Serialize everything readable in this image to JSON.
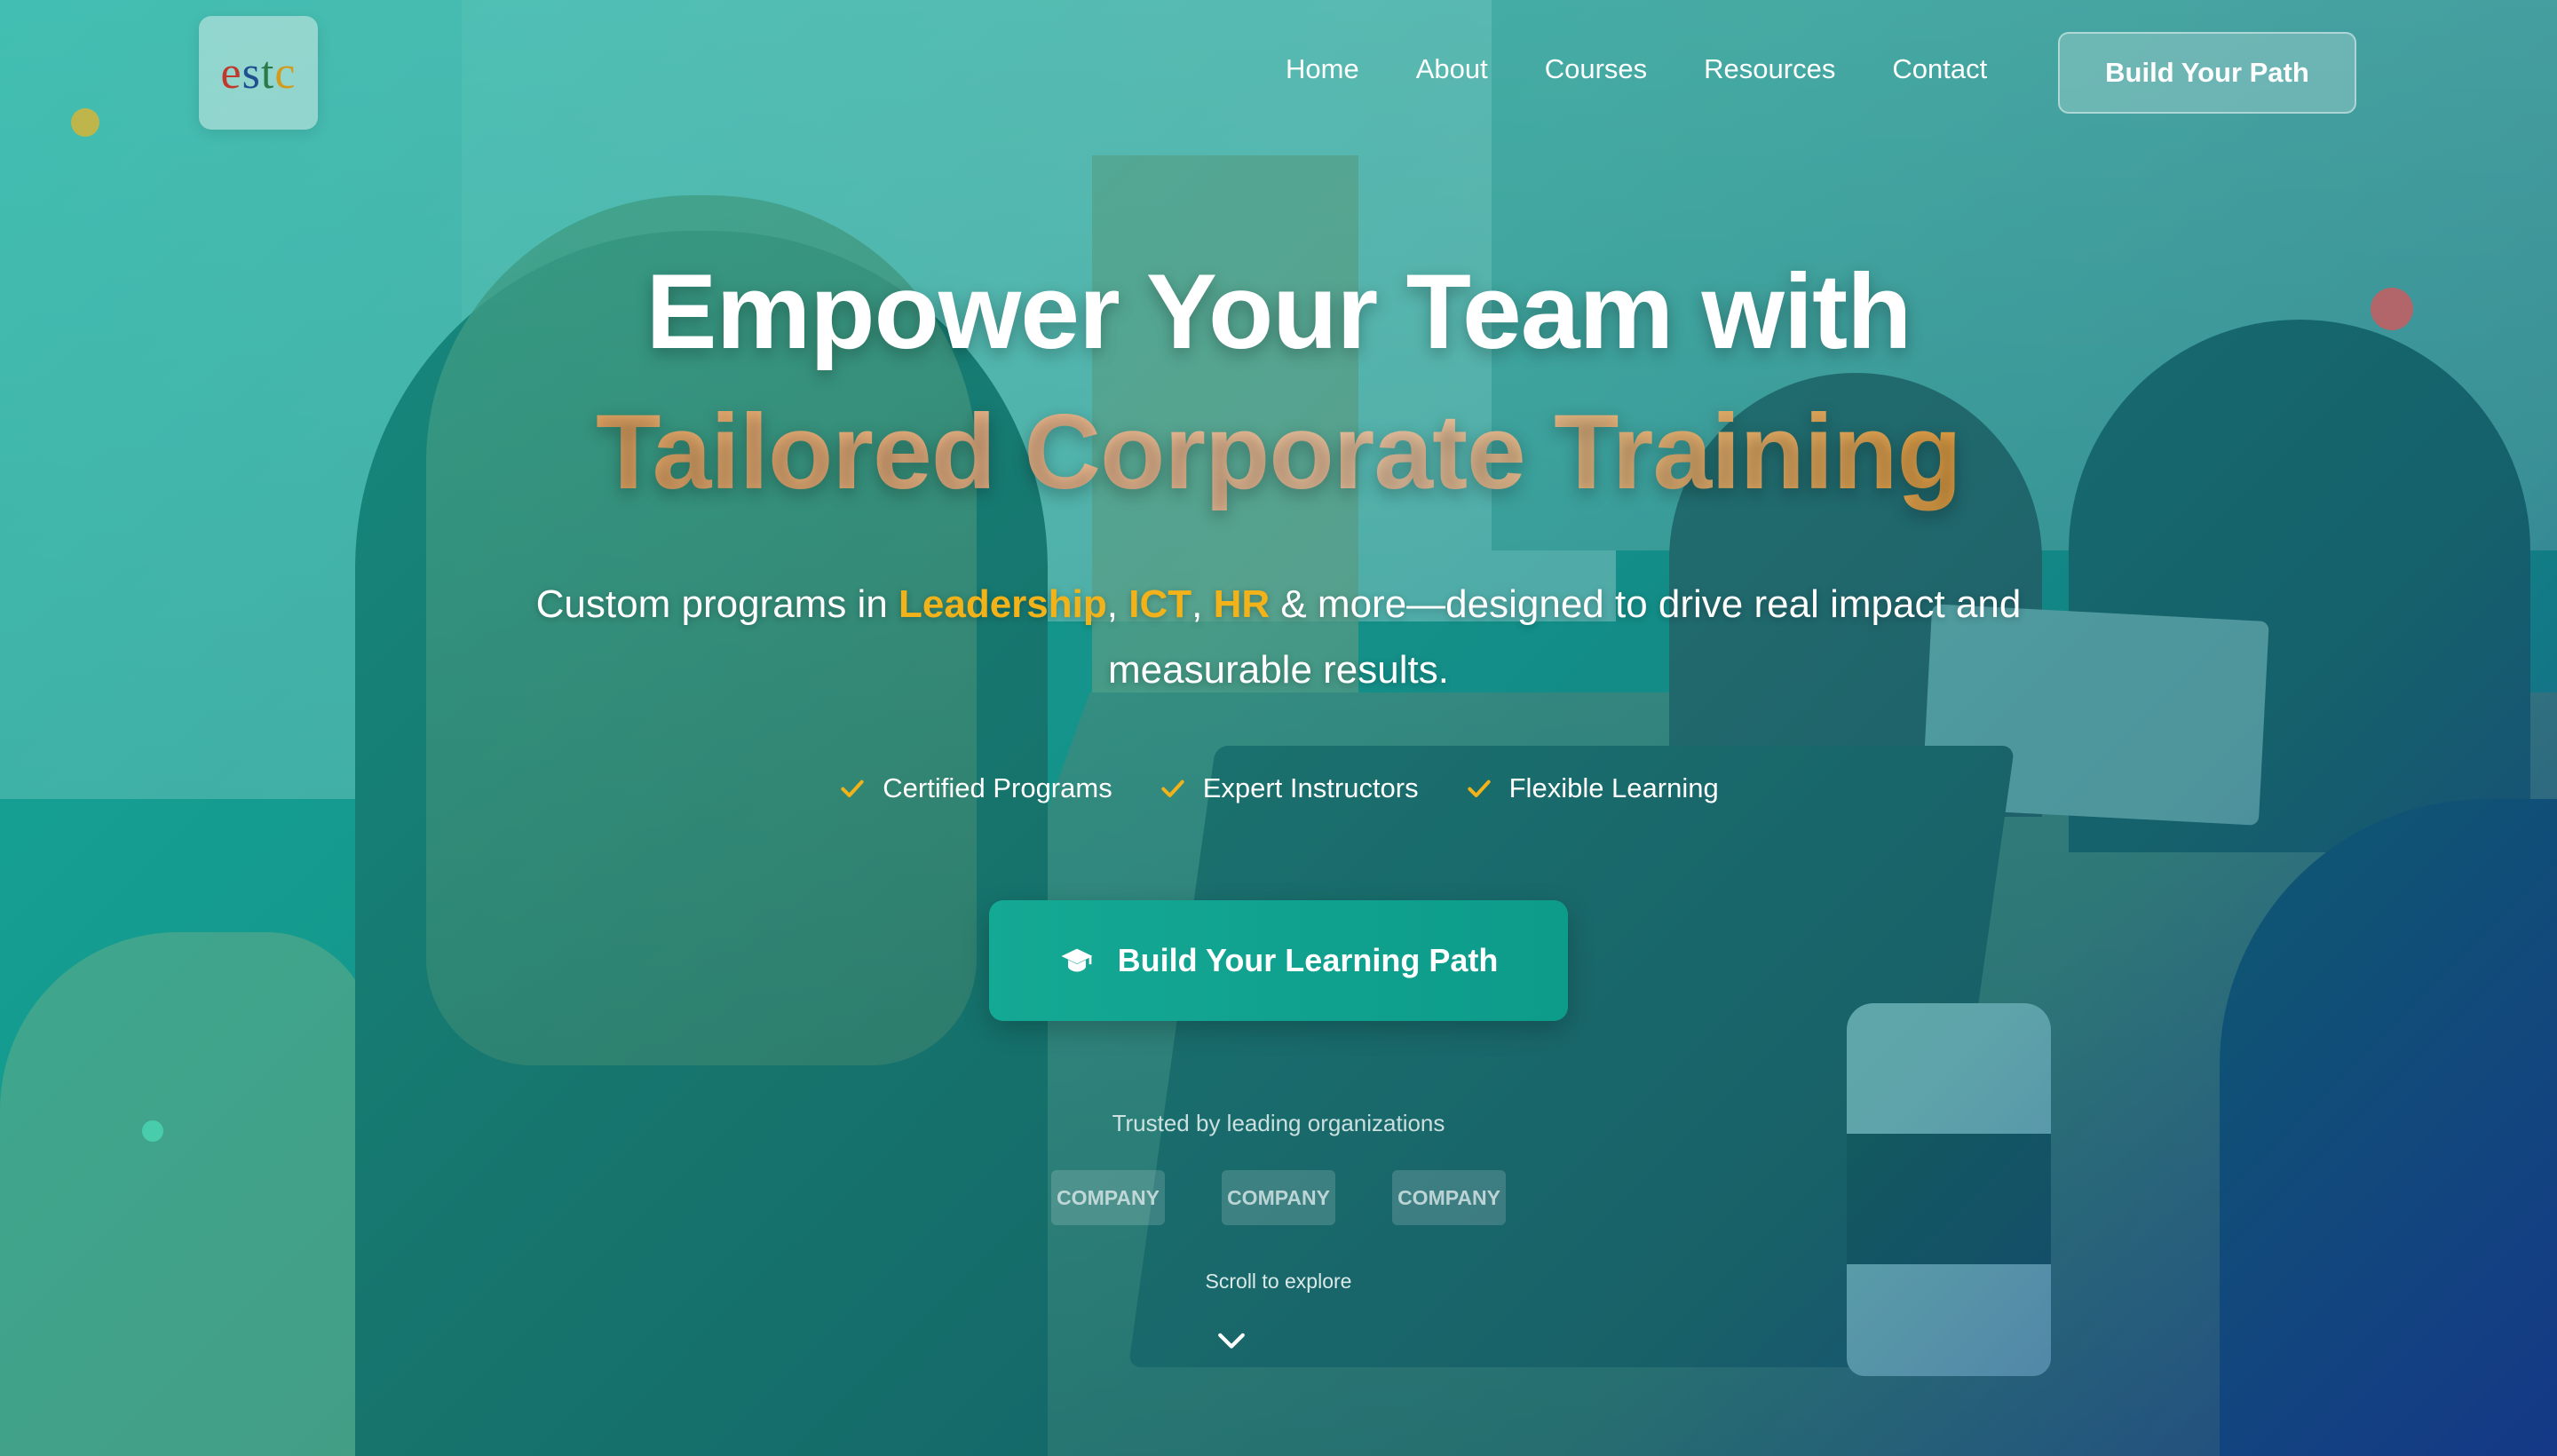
{
  "logo": {
    "letters": [
      "e",
      "s",
      "t",
      "c"
    ]
  },
  "nav": {
    "items": [
      {
        "label": "Home"
      },
      {
        "label": "About"
      },
      {
        "label": "Courses"
      },
      {
        "label": "Resources"
      },
      {
        "label": "Contact"
      }
    ],
    "cta_label": "Build Your Path"
  },
  "hero": {
    "title_line1": "Empower Your Team with",
    "title_line2": "Tailored Corporate Training",
    "subtitle_prefix": "Custom programs in ",
    "subtitle_hl1": "Leadership",
    "subtitle_sep1": ", ",
    "subtitle_hl2": "ICT",
    "subtitle_sep2": ", ",
    "subtitle_hl3": "HR",
    "subtitle_suffix": " & more—designed to drive real impact and measurable results.",
    "features": [
      {
        "label": "Certified Programs",
        "icon": "check-icon"
      },
      {
        "label": "Expert Instructors",
        "icon": "check-icon"
      },
      {
        "label": "Flexible Learning",
        "icon": "check-icon"
      }
    ],
    "cta_label": "Build Your Learning Path",
    "cta_icon": "graduation-cap-icon"
  },
  "trusted": {
    "label": "Trusted by leading organizations",
    "companies": [
      "COMPANY",
      "COMPANY",
      "COMPANY"
    ]
  },
  "scroll": {
    "label": "Scroll to explore",
    "icon": "chevron-down-icon"
  },
  "colors": {
    "accent_teal": "#0d9b8a",
    "highlight_gold": "#f2b219",
    "title_gold": "#e2a24a"
  }
}
